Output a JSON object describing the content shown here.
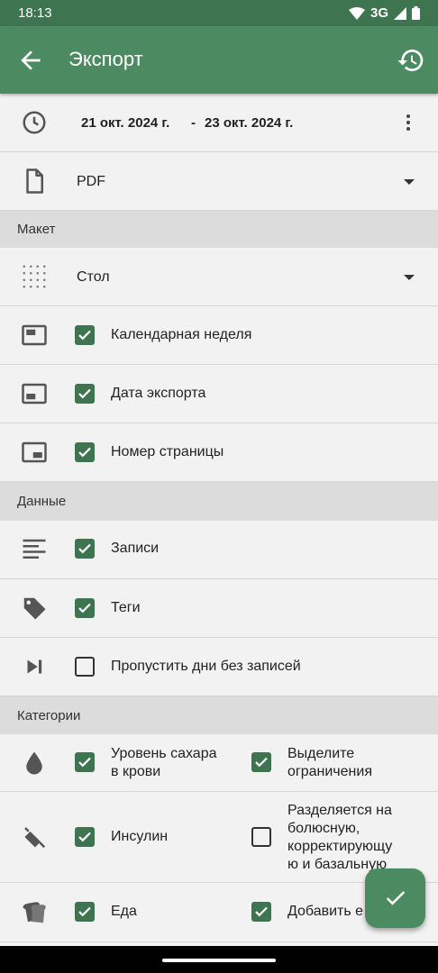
{
  "status_bar": {
    "time": "18:13",
    "network": "3G"
  },
  "app_bar": {
    "title": "Экспорт"
  },
  "date_range": {
    "start": "21 окт. 2024 г.",
    "separator": "-",
    "end": "23 окт. 2024 г."
  },
  "format": {
    "value": "PDF"
  },
  "sections": {
    "layout": "Макет",
    "data": "Данные",
    "categories": "Категории"
  },
  "layout": {
    "style": "Стол",
    "calendar_week": "Календарная неделя",
    "export_date": "Дата экспорта",
    "page_number": "Номер страницы"
  },
  "data": {
    "entries": "Записи",
    "tags": "Теги",
    "skip_empty": "Пропустить дни без записей"
  },
  "categories": {
    "blood_sugar_line1": "Уровень сахара",
    "blood_sugar_line2": "в крови",
    "highlight_line1": "Выделите",
    "highlight_line2": "ограничения",
    "insulin": "Инсулин",
    "split_line1": "Разделяется на",
    "split_line2": "болюсную,",
    "split_line3": "корректирующу",
    "split_line4": "ю и базальную",
    "food": "Еда",
    "add_food": "Добавить е"
  },
  "checks": {
    "calendar_week": true,
    "export_date": true,
    "page_number": true,
    "entries": true,
    "tags": true,
    "skip_empty": false,
    "blood_sugar": true,
    "highlight": true,
    "insulin": true,
    "split": false,
    "food": true,
    "add_food": true
  },
  "colors": {
    "primary": "#4c8b62",
    "primary_dark": "#3f7451",
    "section_bg": "#dcdcdc"
  }
}
